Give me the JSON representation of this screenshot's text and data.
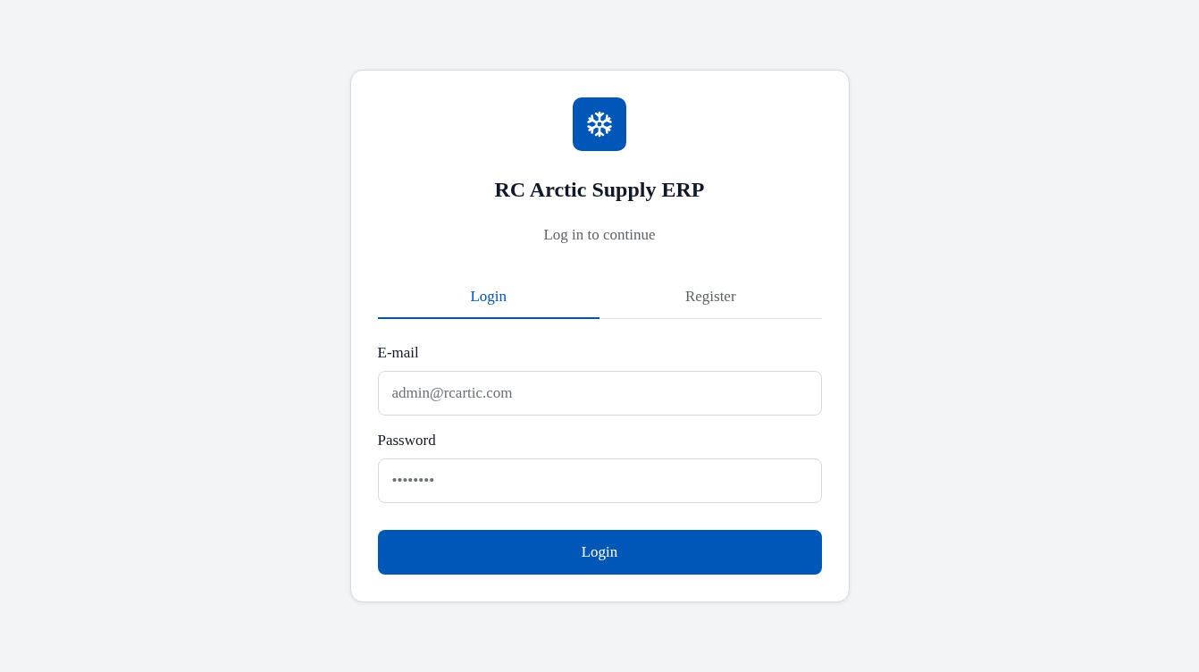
{
  "app": {
    "title": "RC Arctic Supply ERP",
    "subtitle": "Log in to continue"
  },
  "tabs": [
    {
      "label": "Login",
      "selected": true
    },
    {
      "label": "Register",
      "selected": false
    }
  ],
  "fields": [
    {
      "label": "E-mail",
      "placeholder": "admin@rcartic.com"
    },
    {
      "label": "Password",
      "placeholder": "••••••••"
    }
  ],
  "submit_button": "Login"
}
